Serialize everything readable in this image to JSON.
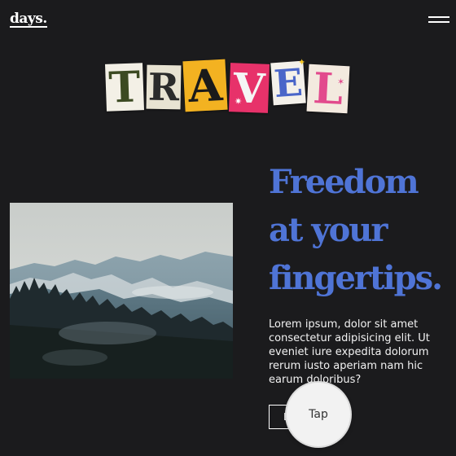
{
  "brand": {
    "logo": "days."
  },
  "hero": {
    "letters": [
      "T",
      "R",
      "A",
      "V",
      "E",
      "L"
    ]
  },
  "headline": {
    "lines": [
      "Freedom",
      "at your",
      "fingertips."
    ]
  },
  "body": {
    "text": "Lorem ipsum, dolor sit amet consectetur adipisicing elit. Ut eveniet iure expedita dolorum rerum iusto aperiam nam hic earum doloribus?"
  },
  "cta": {
    "label": "E"
  },
  "tap_overlay": {
    "label": "Tap"
  },
  "colors": {
    "background": "#1b1b1d",
    "accent": "#4f74d6",
    "text": "#f2f2f2"
  },
  "icons": {
    "menu": "hamburger-menu-icon",
    "image": "misty-mountain-forest-photo"
  }
}
